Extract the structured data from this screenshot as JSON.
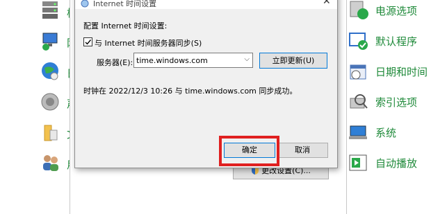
{
  "background": {
    "left_fragments": [
      "桥",
      "网",
      "日",
      "声",
      "文",
      "用"
    ],
    "right_items": [
      {
        "label": "电源选项",
        "icon": "power-options-icon"
      },
      {
        "label": "默认程序",
        "icon": "default-programs-icon"
      },
      {
        "label": "日期和时间",
        "icon": "date-time-icon"
      },
      {
        "label": "索引选项",
        "icon": "indexing-options-icon"
      },
      {
        "label": "系统",
        "icon": "system-icon"
      },
      {
        "label": "自动播放",
        "icon": "autoplay-icon"
      }
    ],
    "change_settings_label": "更改设置(C)..."
  },
  "dialog": {
    "title": "Internet 时间设置",
    "section_label": "配置 Internet 时间设置:",
    "sync_checkbox_label": "与 Internet 时间服务器同步(S)",
    "sync_checked": true,
    "server_label": "服务器(E):",
    "server_value": "time.windows.com",
    "update_button": "立即更新(U)",
    "status_text": "时钟在 2022/12/3 10:26 与 time.windows.com 同步成功。",
    "ok_button": "确定",
    "cancel_button": "取消"
  },
  "colors": {
    "link_green": "#1f8a3a",
    "highlight_red": "#e02020",
    "dialog_bg": "#f0f0f0"
  }
}
